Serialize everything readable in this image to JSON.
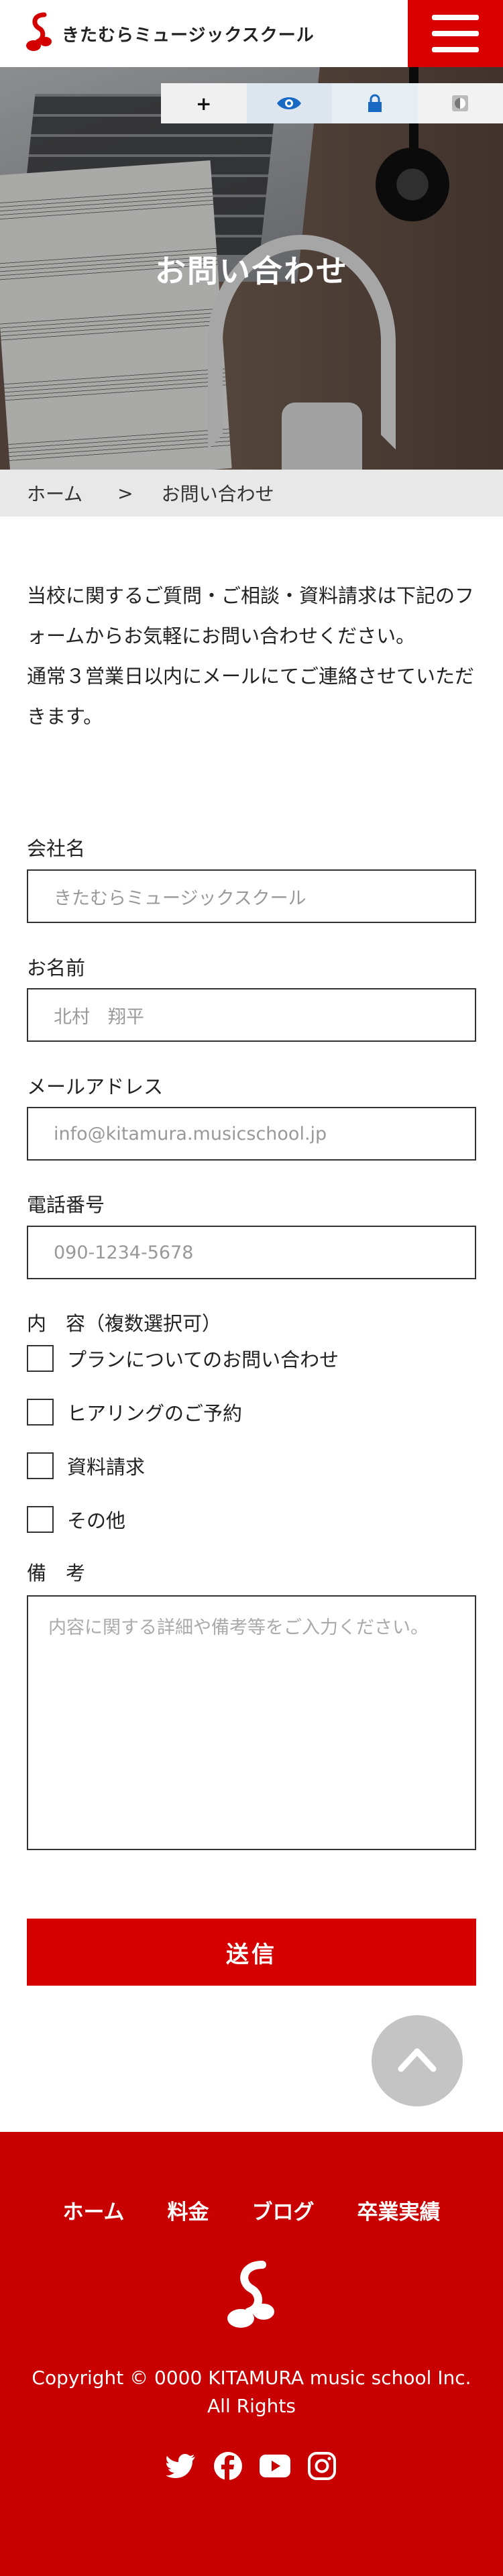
{
  "header": {
    "logo_text": "きたむらミュージックスクール",
    "menu_label": ""
  },
  "a11y_toolbar": {
    "font_plus": "+",
    "eye": "eye-icon",
    "lock": "lock-icon",
    "contrast": "contrast-icon"
  },
  "hero": {
    "title": "お問い合わせ"
  },
  "breadcrumb": {
    "home": "ホーム",
    "separator": ">",
    "current": "お問い合わせ"
  },
  "intro": {
    "line1": "当校に関するご質問・ご相談・資料請求は下記のフォームからお気軽にお問い合わせください。",
    "line2": "通常３営業日以内にメールにてご連絡させていただきます。"
  },
  "form": {
    "company": {
      "label": "会社名",
      "placeholder": "きたむらミュージックスクール"
    },
    "name": {
      "label": "お名前",
      "placeholder": "北村　翔平"
    },
    "email": {
      "label": "メールアドレス",
      "placeholder": "info@kitamura.musicschool.jp"
    },
    "phone": {
      "label": "電話番号",
      "placeholder": "090-1234-5678"
    },
    "content_label": "内　容（複数選択可）",
    "options": [
      "プランについてのお問い合わせ",
      "ヒアリングのご予約",
      "資料請求",
      "その他"
    ],
    "notes": {
      "label": "備　考",
      "placeholder": "内容に関する詳細や備考等をご入力ください。"
    },
    "submit_label": "送信"
  },
  "footer": {
    "nav": [
      "ホーム",
      "料金",
      "ブログ",
      "卒業実績"
    ],
    "copyright": "Copyright © 0000 KITAMURA music school Inc. All Rights",
    "social": [
      "twitter-icon",
      "facebook-icon",
      "youtube-icon",
      "instagram-icon"
    ]
  },
  "colors": {
    "brand_red": "#d50000",
    "footer_red": "#c90000"
  }
}
